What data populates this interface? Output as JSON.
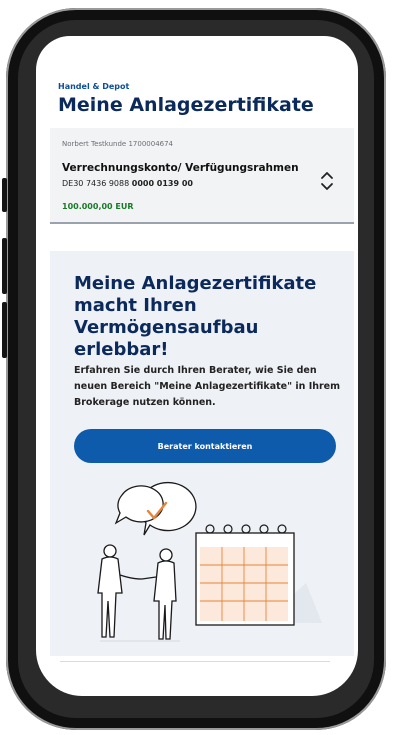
{
  "header": {
    "eyebrow": "Handel & Depot",
    "title": "Meine Anlagezertifikate"
  },
  "account": {
    "owner": "Norbert Testkunde 1700004674",
    "name": "Verrechnungskonto/ Verfügungsrahmen",
    "iban_prefix": "DE30 7436 9088 ",
    "iban_suffix": "0000 0139 00",
    "balance": "100.000,00 EUR",
    "toggle_icon": "chevron-up-down-icon"
  },
  "promo": {
    "title": "Meine Anlagezertifikate macht Ihren Vermögensaufbau erlebbar!",
    "text": "Erfahren Sie durch Ihren Berater, wie Sie den neuen Bereich \"Meine Anlagezertifikate\" in Ihrem Brokerage nutzen können.",
    "cta_label": "Berater kontaktieren",
    "illustration_icons": [
      "advisor-handshake-illustration",
      "calendar-illustration"
    ]
  },
  "colors": {
    "brand_dark": "#0b2a5b",
    "brand_blue": "#0e5bab",
    "positive_green": "#1b7a2a",
    "accent_orange": "#e8833a"
  }
}
